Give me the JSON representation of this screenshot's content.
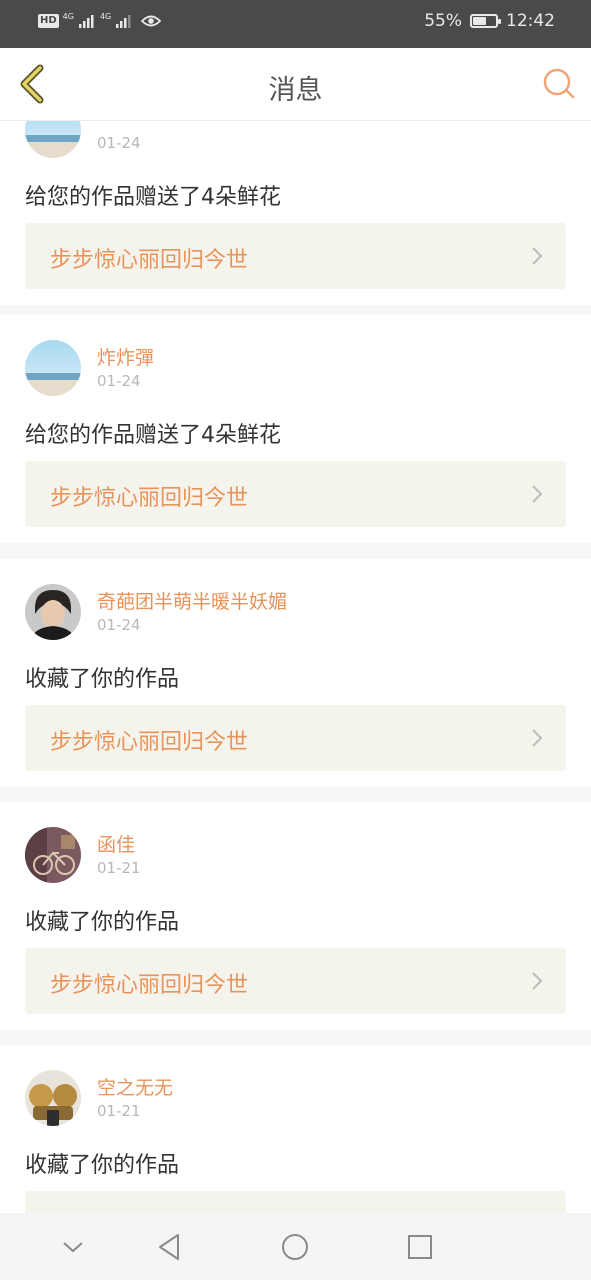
{
  "status_bar": {
    "hd": "HD",
    "network_1": "4G",
    "network_2": "4G",
    "battery_percent": "55%",
    "battery_level": 0.55,
    "time": "12:42"
  },
  "header": {
    "title": "消息",
    "back_icon": "back-chevron-icon",
    "search_icon": "search-icon",
    "accent_color": "#e8935a"
  },
  "messages": [
    {
      "username": "",
      "date": "01-24",
      "action": "给您的作品赠送了4朵鲜花",
      "work_title": "步步惊心丽回归今世",
      "avatar": "beach-avatar"
    },
    {
      "username": "炸炸彈",
      "date": "01-24",
      "action": "给您的作品赠送了4朵鲜花",
      "work_title": "步步惊心丽回归今世",
      "avatar": "beach-avatar"
    },
    {
      "username": "奇葩团半萌半暖半妖媚",
      "date": "01-24",
      "action": "收藏了你的作品",
      "work_title": "步步惊心丽回归今世",
      "avatar": "portrait-avatar"
    },
    {
      "username": "函佳",
      "date": "01-21",
      "action": "收藏了你的作品",
      "work_title": "步步惊心丽回归今世",
      "avatar": "bicycle-avatar"
    },
    {
      "username": "空之无无",
      "date": "01-21",
      "action": "收藏了你的作品",
      "work_title": "",
      "avatar": "figures-avatar"
    }
  ],
  "nav_bar": {
    "icons": [
      "collapse-chevron-icon",
      "back-triangle-icon",
      "home-circle-icon",
      "recents-square-icon"
    ]
  }
}
